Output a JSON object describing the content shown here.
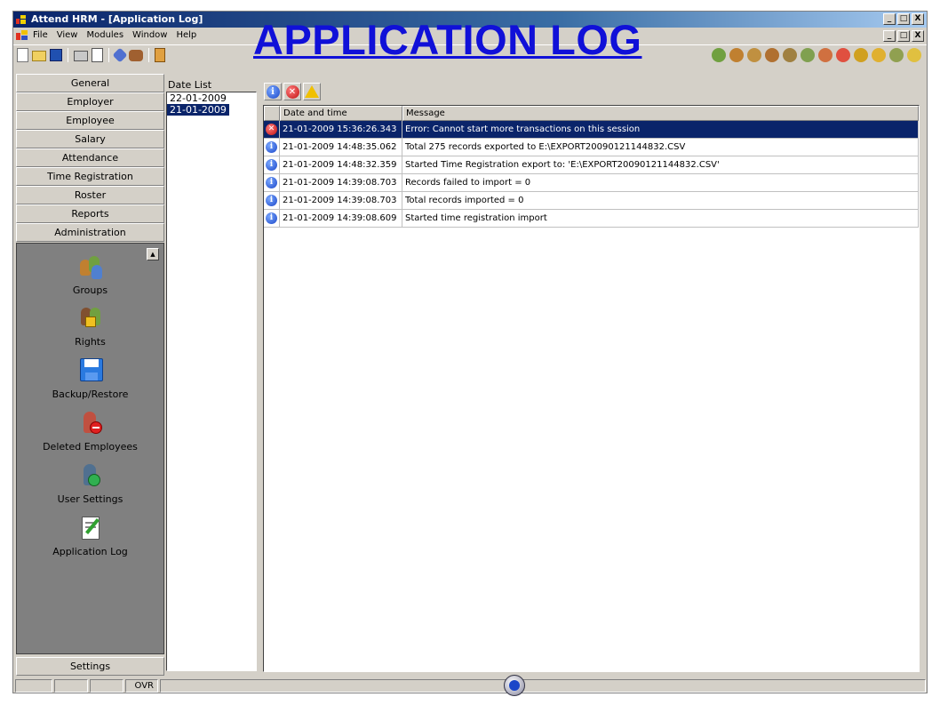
{
  "window": {
    "title": "Attend HRM - [Application Log]",
    "controls": [
      "_",
      "·",
      "X"
    ]
  },
  "menu": {
    "items": [
      "File",
      "View",
      "Modules",
      "Window",
      "Help"
    ]
  },
  "overlay_title": "APPLICATION LOG",
  "toolbar": {
    "left_icons": [
      "new-icon",
      "open-icon",
      "save-icon",
      "print-icon",
      "print-preview-icon",
      "edit-icon",
      "users-icon",
      "exit-icon"
    ],
    "right_icons": [
      "user-add-icon",
      "users-icon",
      "users-group-icon",
      "users-link-icon",
      "users-config-icon",
      "users-export-icon",
      "users-calc-icon",
      "users-gender-icon",
      "wrench-icon",
      "arrow-icon",
      "users-refresh-icon",
      "folder-icon"
    ]
  },
  "sidebar": {
    "nav": [
      "General",
      "Employer",
      "Employee",
      "Salary",
      "Attendance",
      "Time Registration",
      "Roster",
      "Reports",
      "Administration"
    ],
    "items": [
      {
        "label": "Groups",
        "icon": "groups-icon"
      },
      {
        "label": "Rights",
        "icon": "rights-icon"
      },
      {
        "label": "Backup/Restore",
        "icon": "backup-icon"
      },
      {
        "label": "Deleted Employees",
        "icon": "deleted-employees-icon"
      },
      {
        "label": "User Settings",
        "icon": "user-settings-icon"
      },
      {
        "label": "Application Log",
        "icon": "application-log-icon"
      }
    ],
    "settings": "Settings"
  },
  "date_list": {
    "label": "Date List",
    "dates": [
      "22-01-2009",
      "21-01-2009"
    ],
    "selected": "21-01-2009"
  },
  "log": {
    "filters": [
      "info-icon",
      "error-icon",
      "warning-icon"
    ],
    "columns": [
      "Date and time",
      "Message"
    ],
    "rows": [
      {
        "type": "error",
        "datetime": "21-01-2009 15:36:26.343",
        "message": "Error: Cannot start more transactions on this session",
        "selected": true
      },
      {
        "type": "info",
        "datetime": "21-01-2009 14:48:35.062",
        "message": "Total 275 records exported to E:\\EXPORT20090121144832.CSV"
      },
      {
        "type": "info",
        "datetime": "21-01-2009 14:48:32.359",
        "message": "Started Time Registration export to: 'E:\\EXPORT20090121144832.CSV'"
      },
      {
        "type": "info",
        "datetime": "21-01-2009 14:39:08.703",
        "message": "Records failed to import = 0"
      },
      {
        "type": "info",
        "datetime": "21-01-2009 14:39:08.703",
        "message": "Total records imported = 0"
      },
      {
        "type": "info",
        "datetime": "21-01-2009 14:39:08.609",
        "message": "Started time registration import"
      }
    ]
  },
  "status": {
    "mode": "OVR"
  }
}
